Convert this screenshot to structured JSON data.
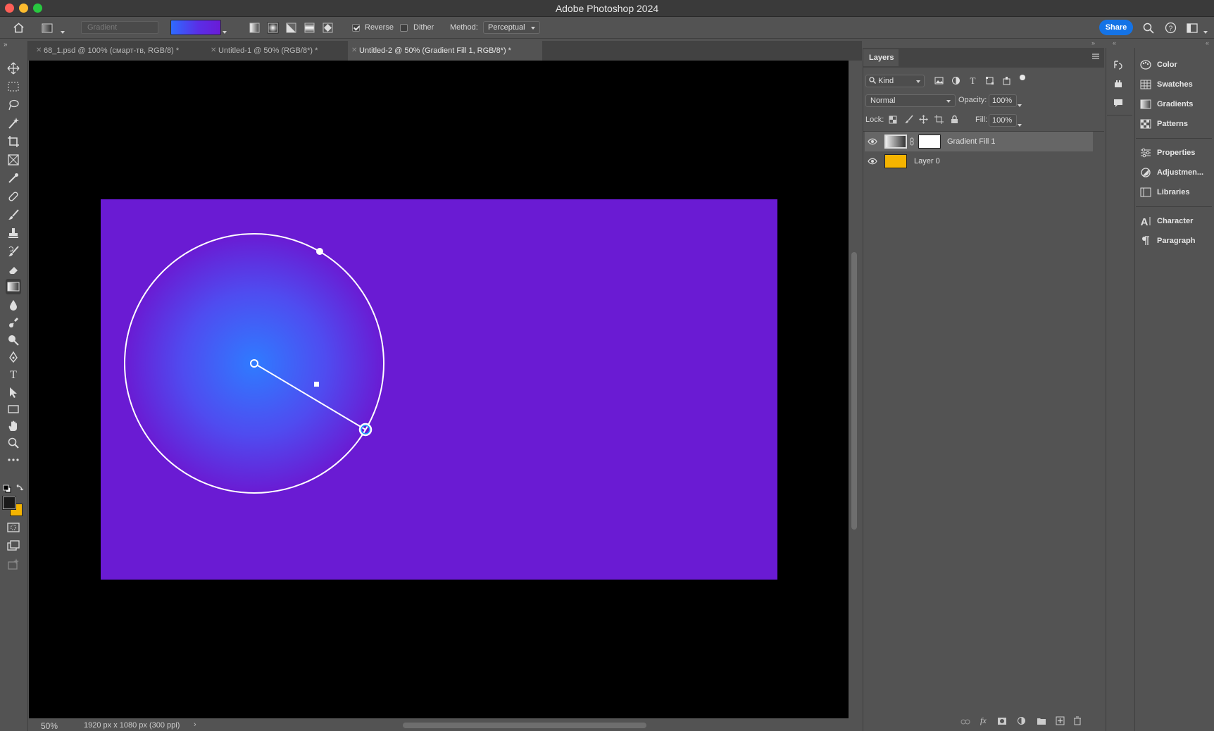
{
  "app": {
    "title": "Adobe Photoshop 2024"
  },
  "options_bar": {
    "preset_dropdown": "Gradient",
    "reverse_label": "Reverse",
    "reverse_checked": true,
    "dither_label": "Dither",
    "dither_checked": false,
    "method_label": "Method:",
    "method_value": "Perceptual",
    "share_label": "Share"
  },
  "tabs": [
    {
      "label": "68_1.psd @ 100% (смарт-тв, RGB/8) *",
      "active": false
    },
    {
      "label": "Untitled-1 @ 50% (RGB/8*) *",
      "active": false
    },
    {
      "label": "Untitled-2 @ 50% (Gradient Fill 1, RGB/8*) *",
      "active": true
    }
  ],
  "status": {
    "zoom": "50%",
    "doc_info": "1920 px x 1080 px (300 ppi)"
  },
  "layers_panel": {
    "tab_label": "Layers",
    "filter_kind": "Kind",
    "blend_mode": "Normal",
    "opacity_label": "Opacity:",
    "opacity_value": "100%",
    "lock_label": "Lock:",
    "fill_label": "Fill:",
    "fill_value": "100%",
    "layers": [
      {
        "name": "Gradient Fill 1",
        "selected": true
      },
      {
        "name": "Layer 0",
        "selected": false
      }
    ]
  },
  "right_dock": {
    "group1": [
      "Color",
      "Swatches",
      "Gradients",
      "Patterns"
    ],
    "group2": [
      "Properties",
      "Adjustmen...",
      "Libraries"
    ],
    "group3": [
      "Character",
      "Paragraph"
    ]
  },
  "colors": {
    "canvas_fill": "#6a1bd3",
    "gradient_center": "#2f7bff",
    "foreground": "#1a1a1a",
    "background": "#f5b400",
    "layer0_color": "#f5b400",
    "accent": "#1473e6"
  }
}
